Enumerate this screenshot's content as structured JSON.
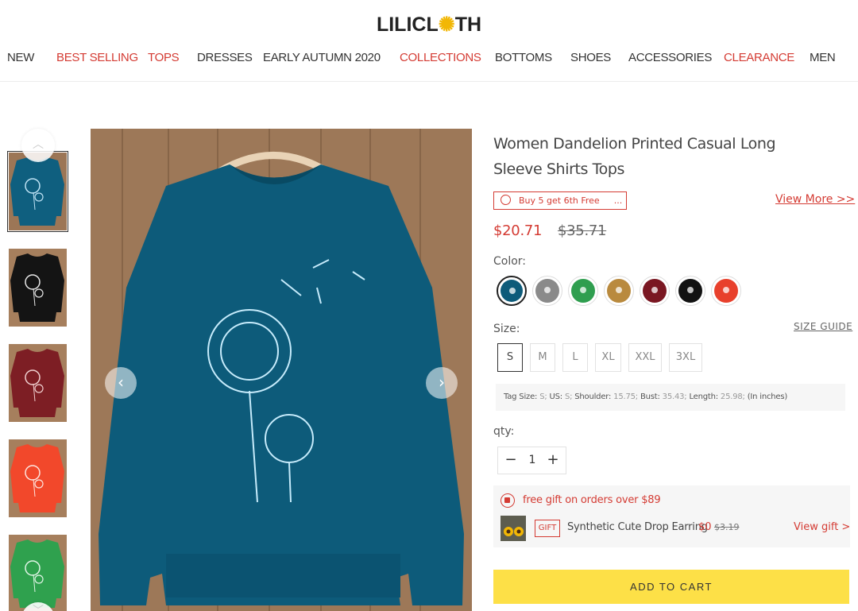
{
  "header": {
    "logo_left": "LILICL",
    "logo_flower": "✺",
    "logo_right": "TH"
  },
  "nav": [
    {
      "label": "NEW",
      "highlight": false
    },
    {
      "label": "BEST SELLING",
      "highlight": true
    },
    {
      "label": "TOPS",
      "highlight": true
    },
    {
      "label": "DRESSES",
      "highlight": false
    },
    {
      "label": "EARLY AUTUMN 2020",
      "highlight": false
    },
    {
      "label": "COLLECTIONS",
      "highlight": true
    },
    {
      "label": "BOTTOMS",
      "highlight": false
    },
    {
      "label": "SHOES",
      "highlight": false
    },
    {
      "label": "ACCESSORIES",
      "highlight": false
    },
    {
      "label": "CLEARANCE",
      "highlight": true
    },
    {
      "label": "MEN",
      "highlight": false
    }
  ],
  "gallery": {
    "up_icon": "︿",
    "down_icon": "﹀",
    "prev_icon": "‹",
    "next_icon": "›",
    "thumbnails": [
      {
        "color": "#0f5f7f",
        "selected": true
      },
      {
        "color": "#141414",
        "selected": false
      },
      {
        "color": "#7d1e24",
        "selected": false
      },
      {
        "color": "#f2482b",
        "selected": false
      },
      {
        "color": "#2fa14e",
        "selected": false
      }
    ],
    "main_color": "#0d5b7a"
  },
  "product": {
    "title": "Women Dandelion Printed Casual Long Sleeve Shirts Tops",
    "promo": "Buy 5 get 6th Free",
    "promo_more": "...",
    "view_more": "View More >>",
    "price": "$20.71",
    "old_price": "$35.71",
    "color_label": "Color:",
    "colors": [
      {
        "name": "blue",
        "hex": "#0d5b7a",
        "selected": true
      },
      {
        "name": "grey",
        "hex": "#8a8a8a",
        "selected": false
      },
      {
        "name": "green",
        "hex": "#2f9e4f",
        "selected": false
      },
      {
        "name": "khaki",
        "hex": "#b98a3e",
        "selected": false
      },
      {
        "name": "wine",
        "hex": "#7a1722",
        "selected": false
      },
      {
        "name": "black",
        "hex": "#121212",
        "selected": false
      },
      {
        "name": "red",
        "hex": "#e8402c",
        "selected": false
      }
    ],
    "size_label": "Size:",
    "size_guide": "SIZE GUIDE",
    "sizes": [
      "S",
      "M",
      "L",
      "XL",
      "XXL",
      "3XL"
    ],
    "selected_size": "S",
    "size_info": {
      "tag_label": "Tag Size:",
      "tag_value": "S;",
      "us_label": "US:",
      "us_value": "S;",
      "shoulder_label": "Shoulder:",
      "shoulder_value": "15.75;",
      "bust_label": "Bust:",
      "bust_value": "35.43;",
      "length_label": "Length:",
      "length_value": "25.98;",
      "unit": "(In inches)"
    },
    "qty_label": "qty:",
    "qty_minus": "−",
    "qty_value": "1",
    "qty_plus": "+",
    "gift": {
      "text": "free gift on orders over $89",
      "tag": "GIFT",
      "name": "Synthetic Cute Drop Earring",
      "price": "$0",
      "old_price": "$3.19",
      "view": "View gift >"
    },
    "add_to_cart": "ADD TO CART"
  }
}
